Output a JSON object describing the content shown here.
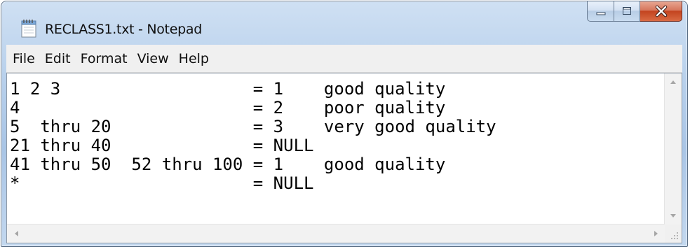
{
  "window": {
    "title": "RECLASS1.txt - Notepad",
    "app_icon": "notepad-icon",
    "controls": {
      "minimize_icon": "minimize-icon",
      "maximize_icon": "maximize-icon",
      "close_icon": "close-icon",
      "close_color": "#c7432a"
    }
  },
  "menu": {
    "items": [
      {
        "label": "File"
      },
      {
        "label": "Edit"
      },
      {
        "label": "Format"
      },
      {
        "label": "View"
      },
      {
        "label": "Help"
      }
    ]
  },
  "document": {
    "lines": [
      "1 2 3                   = 1    good quality",
      "4                       = 2    poor quality",
      "5  thru 20              = 3    very good quality",
      "21 thru 40              = NULL",
      "41 thru 50  52 thru 100 = 1    good quality",
      "*                       = NULL"
    ]
  },
  "scrollbars": {
    "vertical": {
      "up_icon": "scroll-up-arrow-icon",
      "down_icon": "scroll-down-arrow-icon"
    },
    "horizontal": {
      "left_icon": "scroll-left-arrow-icon",
      "right_icon": "scroll-right-arrow-icon"
    },
    "grip_icon": "resize-grip-icon"
  }
}
